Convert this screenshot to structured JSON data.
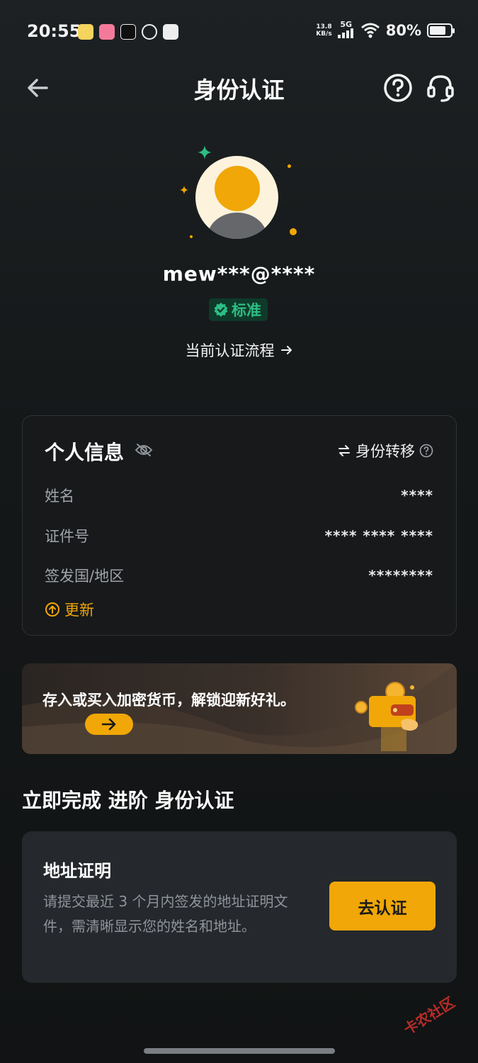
{
  "status_bar": {
    "time": "20:55",
    "net_speed": "13.8",
    "net_unit": "KB/s",
    "network": "5G",
    "battery": "80%",
    "battery_level": 0.8,
    "app_icons": [
      "notes-icon",
      "bilibili-icon",
      "capcut-icon",
      "weibo-icon",
      "taobao-icon"
    ]
  },
  "header": {
    "title": "身份认证",
    "icons": [
      "back-arrow-icon",
      "help-icon",
      "headset-icon"
    ]
  },
  "profile": {
    "username": "mew***@****",
    "badge": "标准",
    "flow_link": "当前认证流程"
  },
  "personal_info": {
    "title": "个人信息",
    "transfer_label": "身份转移",
    "rows": [
      {
        "label": "姓名",
        "value": "****"
      },
      {
        "label": "证件号",
        "value": "**** **** ****"
      },
      {
        "label": "签发国/地区",
        "value": "********"
      }
    ],
    "update_label": "更新"
  },
  "promo": {
    "text": "存入或买入加密货币，解锁迎新好礼。"
  },
  "advanced": {
    "section_title": "立即完成 进阶 身份认证",
    "card_title": "地址证明",
    "card_desc": "请提交最近 3 个月内签发的地址证明文件，需清晰显示您的姓名和地址。",
    "button_label": "去认证"
  },
  "colors": {
    "accent": "#f0a707",
    "success": "#2ebd85",
    "background": "#151819"
  }
}
